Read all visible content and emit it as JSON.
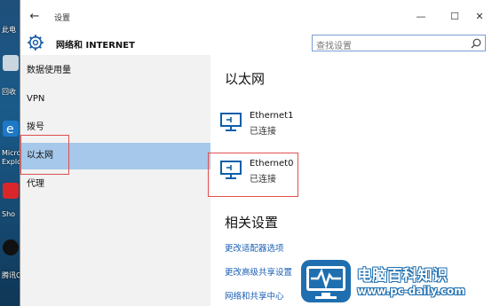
{
  "desktop": {
    "items": [
      {
        "label": "此电"
      },
      {
        "label": "回收"
      },
      {
        "label": "Micro\nExplo"
      },
      {
        "label": "Sho"
      },
      {
        "label": "腾讯Q"
      }
    ]
  },
  "window": {
    "title": "设置",
    "controls": {
      "minimize": "—",
      "maximize": "☐",
      "close": "✕"
    },
    "back": "←"
  },
  "header": {
    "title": "网络和 INTERNET",
    "search_placeholder": "查找设置"
  },
  "sidebar": {
    "items": [
      {
        "label": "数据使用量"
      },
      {
        "label": "VPN"
      },
      {
        "label": "拨号"
      },
      {
        "label": "以太网",
        "selected": true
      },
      {
        "label": "代理"
      }
    ]
  },
  "content": {
    "heading": "以太网",
    "networks": [
      {
        "name": "Ethernet1",
        "status": "已连接"
      },
      {
        "name": "Ethernet0",
        "status": "已连接"
      }
    ],
    "related_heading": "相关设置",
    "links": [
      {
        "label": "更改适配器选项"
      },
      {
        "label": "更改高级共享设置"
      },
      {
        "label": "网络和共享中心"
      }
    ]
  },
  "watermark": {
    "title": "电脑百科知识",
    "url": "www.pc-daily.com"
  },
  "colors": {
    "selected_bg": "#a6c8ea",
    "link": "#1a5fb4",
    "highlight_box": "#e05050",
    "icon_blue": "#0b5fa8"
  }
}
